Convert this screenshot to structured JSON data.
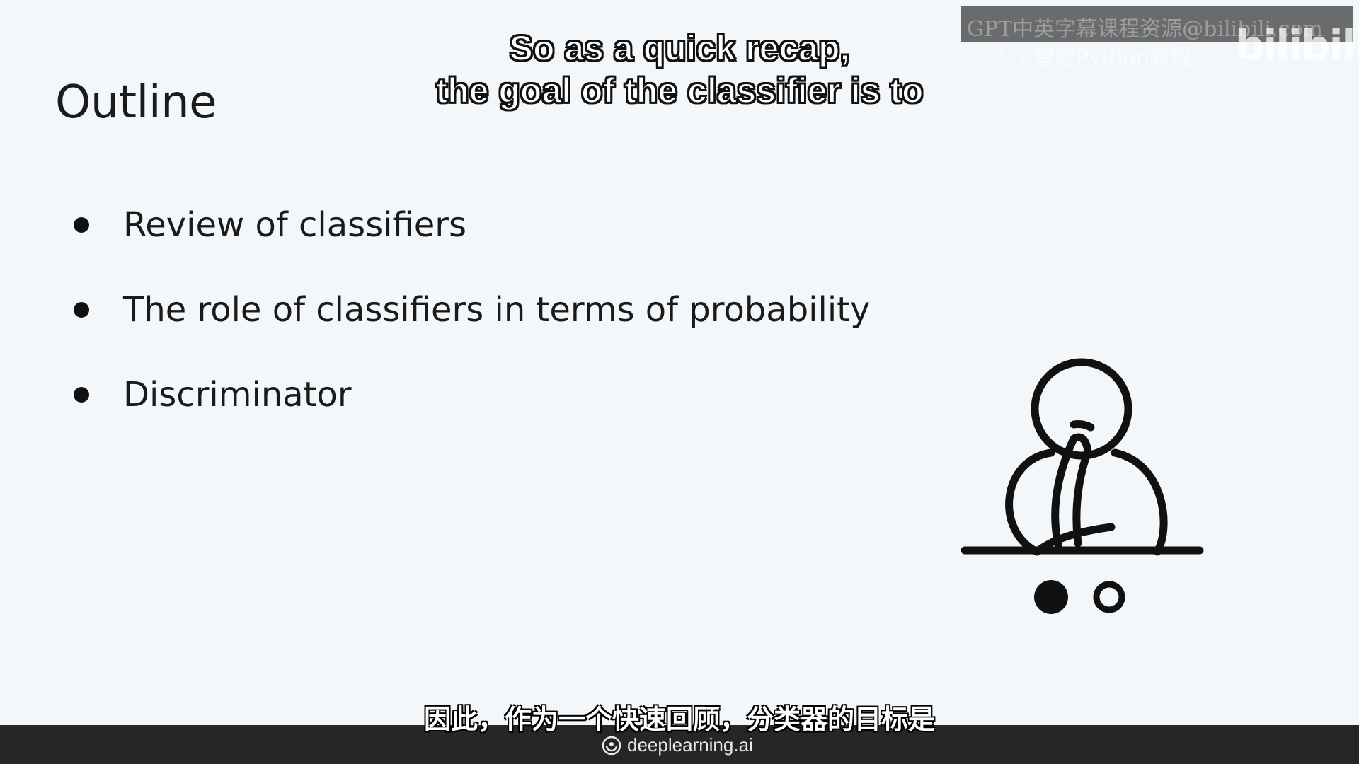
{
  "slide": {
    "title": "Outline",
    "bullets": [
      "Review of classifiers",
      "The role of classifiers in terms of probability",
      "Discriminator"
    ]
  },
  "subtitles": {
    "english_line1": "So as a quick recap,",
    "english_line2": "the goal of the classifier is to",
    "chinese": "因此，作为一个快速回顾，分类器的目标是"
  },
  "watermark": {
    "line1": "GPT中英字幕课程资源@bilibili.com",
    "line2": "人工智能Python教程",
    "logo": "bilibili"
  },
  "footer": {
    "brand": "deeplearning.ai",
    "background": "#262626"
  },
  "icons": [
    "thinking-person-illustration",
    "deeplearning-logo-icon"
  ],
  "colors": {
    "slide_background": "#f3f7fa",
    "text": "#1a1a1a"
  }
}
